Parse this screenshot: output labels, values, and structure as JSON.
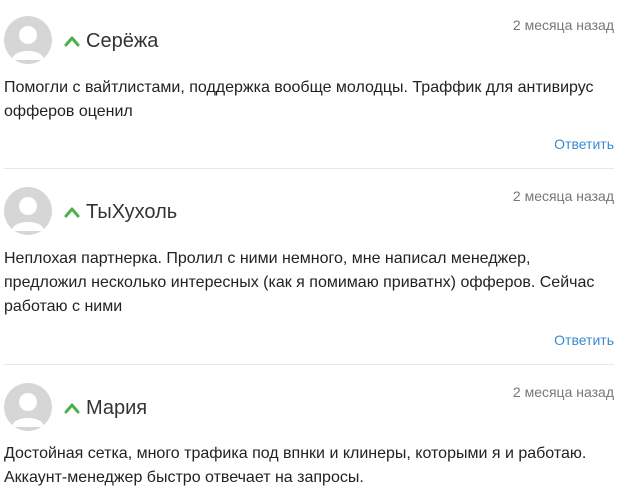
{
  "colors": {
    "vote_icon": "#4caf50",
    "reply_link": "#3a8ad1",
    "avatar_bg": "#d6d6d6",
    "avatar_fg": "#ffffff"
  },
  "icons": {
    "avatar": "default-user-avatar-icon",
    "vote": "chevron-up-icon"
  },
  "comments": [
    {
      "author": "Серёжа",
      "date": "2 месяца назад",
      "text": "Помогли с вайтлистами, поддержка вообще молодцы. Траффик для антивирус офферов оценил",
      "reply_label": "Ответить"
    },
    {
      "author": "ТыХухоль",
      "date": "2 месяца назад",
      "text": "Неплохая партнерка. Пролил с ними немного, мне написал менеджер, предложил несколько интересных (как я помимаю приватнх) офферов. Сейчас работаю с ними",
      "reply_label": "Ответить"
    },
    {
      "author": "Мария",
      "date": "2 месяца назад",
      "text": "Достойная сетка, много трафика под впнки и клинеры, которыми я и работаю. Аккаунт-менеджер быстро отвечает на запросы."
    }
  ]
}
